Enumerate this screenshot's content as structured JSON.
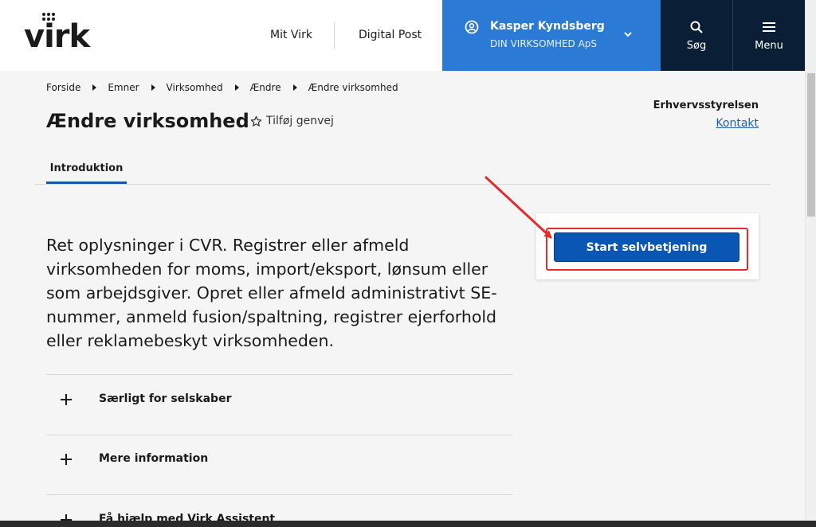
{
  "header": {
    "logo_text": "virk",
    "nav_links": [
      "Mit Virk",
      "Digital Post"
    ],
    "user": {
      "name": "Kasper Kyndsberg",
      "company": "DIN VIRKSOMHED ApS"
    },
    "search_label": "Søg",
    "menu_label": "Menu"
  },
  "breadcrumb": [
    "Forside",
    "Emner",
    "Virksomhed",
    "Ændre",
    "Ændre virksomhed"
  ],
  "page": {
    "title": "Ændre virksomhed",
    "shortcut_label": "Tilføj genvej",
    "org_name": "Erhvervsstyrelsen",
    "contact_label": "Kontakt",
    "tab_label": "Introduktion",
    "intro": "Ret oplysninger i CVR. Registrer eller afmeld virksomheden for moms, import/eksport, lønsum eller som arbejdsgiver. Opret eller afmeld administrativt SE-nummer, anmeld fusion/spaltning, registrer ejerforhold eller reklamebeskyt virksomheden.",
    "cta_label": "Start selvbetjening"
  },
  "accordion": [
    {
      "label": "Særligt for selskaber"
    },
    {
      "label": "Mere information"
    },
    {
      "label": "Få hjælp med Virk Assistent"
    }
  ],
  "colors": {
    "user_box": "#2b7ad6",
    "header_dark": "#0a1e36",
    "cta": "#0a56b5",
    "annotation": "#e32c2c"
  }
}
